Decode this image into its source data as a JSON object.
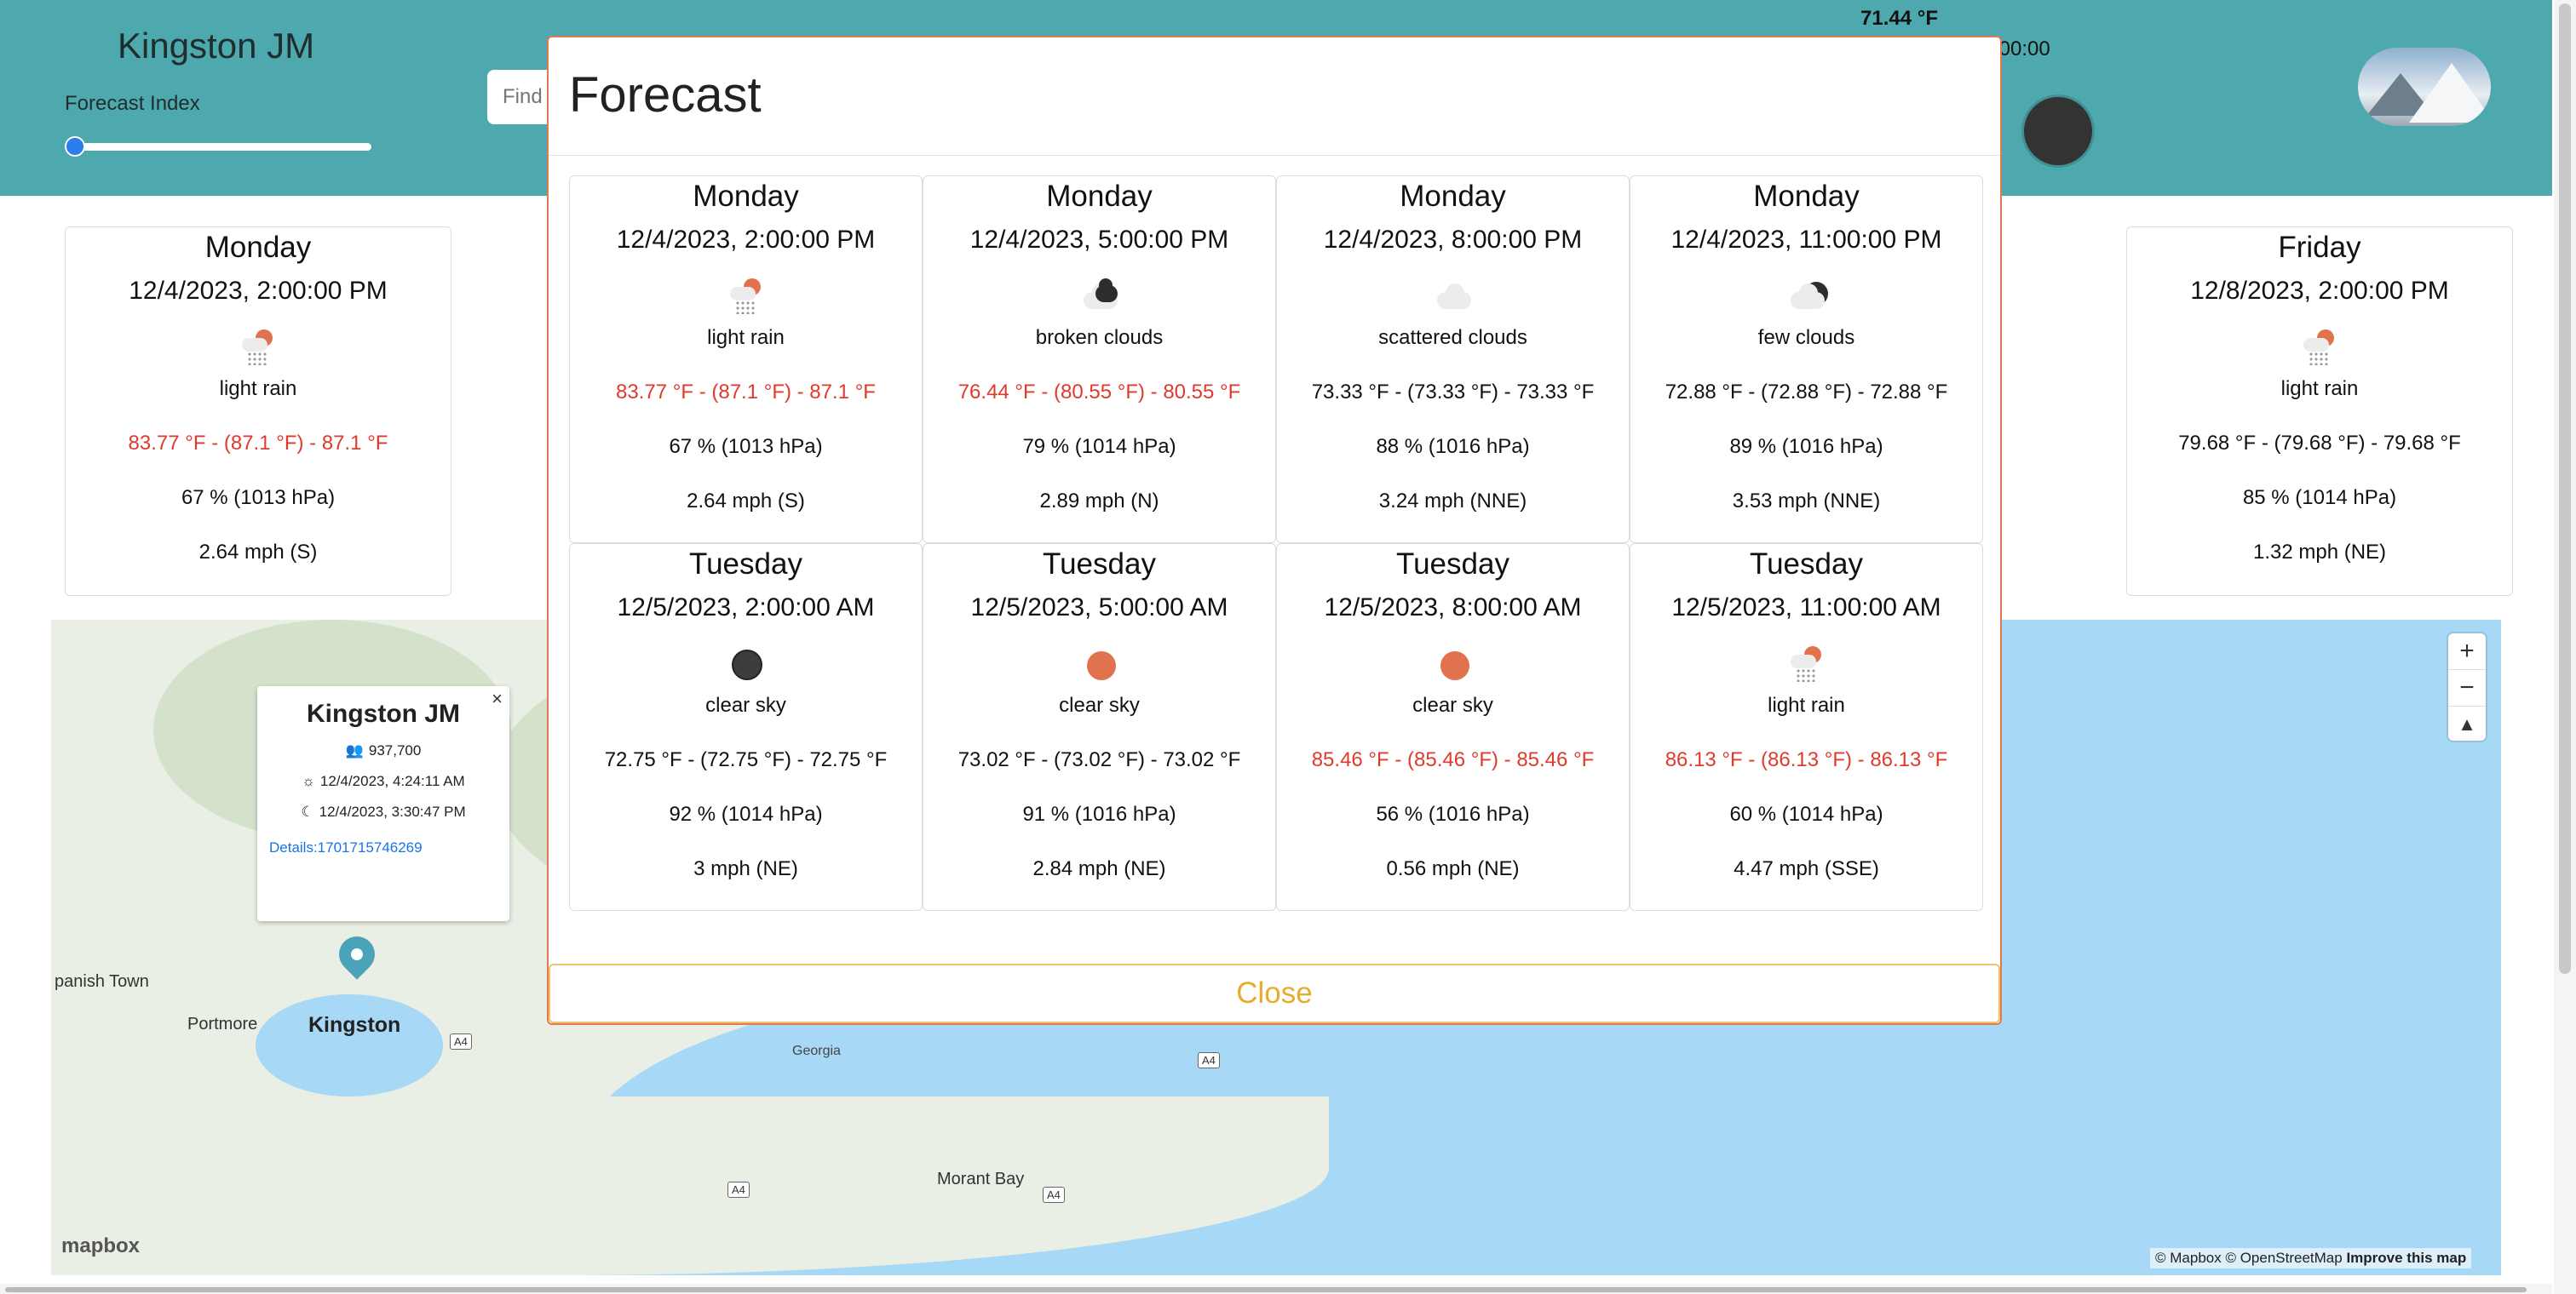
{
  "header": {
    "city": "Kingston JM",
    "index_label": "Forecast Index",
    "search_placeholder": "Find",
    "current_temp": "71.44 °F",
    "time_fragment": ":00:00",
    "slider_value_fraction": 0
  },
  "bg_cards": [
    {
      "day": "Monday",
      "datetime": "12/4/2023, 2:00:00 PM",
      "icon": "light-rain-icon",
      "description": "light rain",
      "temp": "83.77 °F - (87.1 °F) - 87.1 °F",
      "hot": true,
      "humidity": "67 % (1013 hPa)",
      "wind": "2.64 mph (S)"
    },
    {
      "day": "Friday",
      "datetime": "12/8/2023, 2:00:00 PM",
      "icon": "light-rain-icon",
      "description": "light rain",
      "temp": "79.68 °F - (79.68 °F) - 79.68 °F",
      "hot": false,
      "humidity": "85 % (1014 hPa)",
      "wind": "1.32 mph (NE)"
    }
  ],
  "map": {
    "popup": {
      "close": "×",
      "title": "Kingston JM",
      "population": "937,700",
      "sunrise": "12/4/2023, 4:24:11 AM",
      "sunset": "12/4/2023, 3:30:47 PM",
      "details_link": "Details:1701715746269"
    },
    "labels": {
      "spanish_town": "panish Town",
      "portmore": "Portmore",
      "kingston": "Kingston",
      "georgia": "Georgia",
      "morant_bay": "Morant Bay"
    },
    "road": "A4",
    "zoom_in": "+",
    "zoom_out": "−",
    "compass": "▲",
    "logo": "mapbox",
    "attribution": "© Mapbox © OpenStreetMap",
    "improve": "Improve this map"
  },
  "modal": {
    "title": "Forecast",
    "close_label": "Close",
    "cards": [
      {
        "day": "Monday",
        "datetime": "12/4/2023, 2:00:00 PM",
        "icon": "light-rain-icon",
        "description": "light rain",
        "temp": "83.77 °F - (87.1 °F) - 87.1 °F",
        "hot": true,
        "humidity": "67 % (1013 hPa)",
        "wind": "2.64 mph (S)"
      },
      {
        "day": "Monday",
        "datetime": "12/4/2023, 5:00:00 PM",
        "icon": "broken-clouds-icon",
        "description": "broken clouds",
        "temp": "76.44 °F - (80.55 °F) - 80.55 °F",
        "hot": true,
        "humidity": "79 % (1014 hPa)",
        "wind": "2.89 mph (N)"
      },
      {
        "day": "Monday",
        "datetime": "12/4/2023, 8:00:00 PM",
        "icon": "scattered-clouds-icon",
        "description": "scattered clouds",
        "temp": "73.33 °F - (73.33 °F) - 73.33 °F",
        "hot": false,
        "humidity": "88 % (1016 hPa)",
        "wind": "3.24 mph (NNE)"
      },
      {
        "day": "Monday",
        "datetime": "12/4/2023, 11:00:00 PM",
        "icon": "few-clouds-icon",
        "description": "few clouds",
        "temp": "72.88 °F - (72.88 °F) - 72.88 °F",
        "hot": false,
        "humidity": "89 % (1016 hPa)",
        "wind": "3.53 mph (NNE)"
      },
      {
        "day": "Tuesday",
        "datetime": "12/5/2023, 2:00:00 AM",
        "icon": "clear-night-icon",
        "description": "clear sky",
        "temp": "72.75 °F - (72.75 °F) - 72.75 °F",
        "hot": false,
        "humidity": "92 % (1014 hPa)",
        "wind": "3 mph (NE)"
      },
      {
        "day": "Tuesday",
        "datetime": "12/5/2023, 5:00:00 AM",
        "icon": "clear-day-icon",
        "description": "clear sky",
        "temp": "73.02 °F - (73.02 °F) - 73.02 °F",
        "hot": false,
        "humidity": "91 % (1016 hPa)",
        "wind": "2.84 mph (NE)"
      },
      {
        "day": "Tuesday",
        "datetime": "12/5/2023, 8:00:00 AM",
        "icon": "clear-day-icon",
        "description": "clear sky",
        "temp": "85.46 °F - (85.46 °F) - 85.46 °F",
        "hot": true,
        "humidity": "56 % (1016 hPa)",
        "wind": "0.56 mph (NE)"
      },
      {
        "day": "Tuesday",
        "datetime": "12/5/2023, 11:00:00 AM",
        "icon": "light-rain-icon",
        "description": "light rain",
        "temp": "86.13 °F - (86.13 °F) - 86.13 °F",
        "hot": true,
        "humidity": "60 % (1014 hPa)",
        "wind": "4.47 mph (SSE)"
      }
    ]
  },
  "colors": {
    "header": "#4da9ad",
    "hot_temp": "#e03a2c",
    "close_button": "#e6ad2a",
    "modal_border": "#e07a55",
    "sea": "#a7d8f5"
  }
}
